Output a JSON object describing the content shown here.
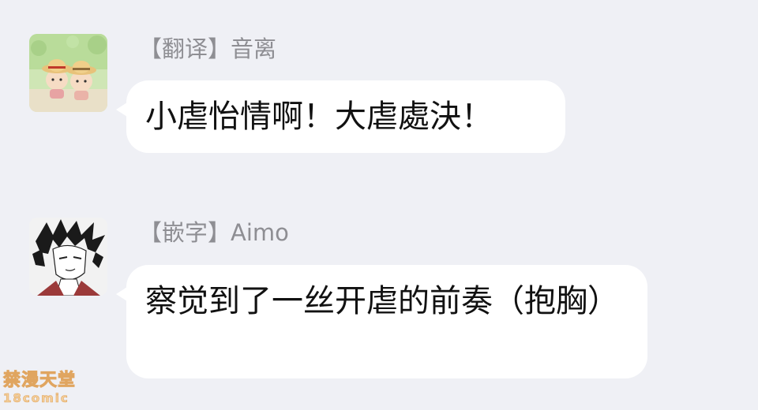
{
  "messages": [
    {
      "sender": "【翻译】音离",
      "text": "小虐怡情啊！大虐處決！",
      "avatar": "two-chibi-straw-hat-characters-avatar"
    },
    {
      "sender": "【嵌字】Aimo",
      "text": "察觉到了一丝开虐的前奏（抱胸）",
      "avatar": "dark-haired-anime-character-avatar"
    }
  ],
  "watermark": {
    "line1": "禁漫天堂",
    "line2": "18comic"
  },
  "colors": {
    "background": "#eff0f5",
    "bubble": "#ffffff",
    "sender_text": "#8e8e93",
    "message_text": "#111111"
  }
}
